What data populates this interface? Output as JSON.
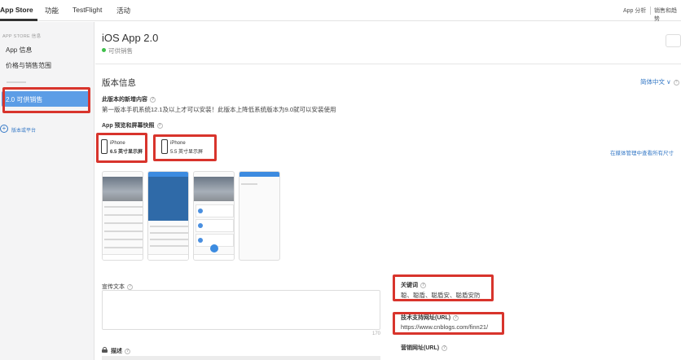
{
  "topbar": {
    "tabs": [
      "App Store",
      "功能",
      "TestFlight",
      "活动"
    ],
    "right": [
      "App 分析",
      "销售和趋势"
    ]
  },
  "sidebar": {
    "section": "APP STORE 信息",
    "items": [
      "App 信息",
      "价格与销售范围"
    ],
    "active": "2.0 可供销售",
    "add_platform": "版本或平台"
  },
  "app": {
    "title": "iOS App 2.0",
    "status": "可供销售",
    "status_color": "#3fbf4b"
  },
  "version_info": {
    "title": "版本信息",
    "language": "简体中文 ∨",
    "whats_new_label": "此版本的新增内容",
    "whats_new_text": "第一版本手机系统12.1及以上才可以安装！此版本上降低系统版本为9.0就可以安装使用",
    "preview_label": "App 预览和屏幕快照",
    "devices": [
      {
        "name": "iPhone",
        "size": "6.5 英寸显示屏"
      },
      {
        "name": "iPhone",
        "size": "5.5 英寸显示屏"
      }
    ],
    "media_link": "在媒体管理中查看所有尺寸",
    "promo_label": "宣传文本",
    "promo_counter": "170",
    "description_label": "描述",
    "keywords_label": "关键词",
    "keywords_value": "聪、聪盾、聪盾安、聪盾安防",
    "support_url_label": "技术支持网址(URL)",
    "support_url_value": "https://www.cnblogs.com/finn21/",
    "marketing_url_label": "营销网址(URL)"
  },
  "colors": {
    "accent": "#3478c6",
    "active_bg": "#5c9de6",
    "highlight": "#d8342c"
  }
}
